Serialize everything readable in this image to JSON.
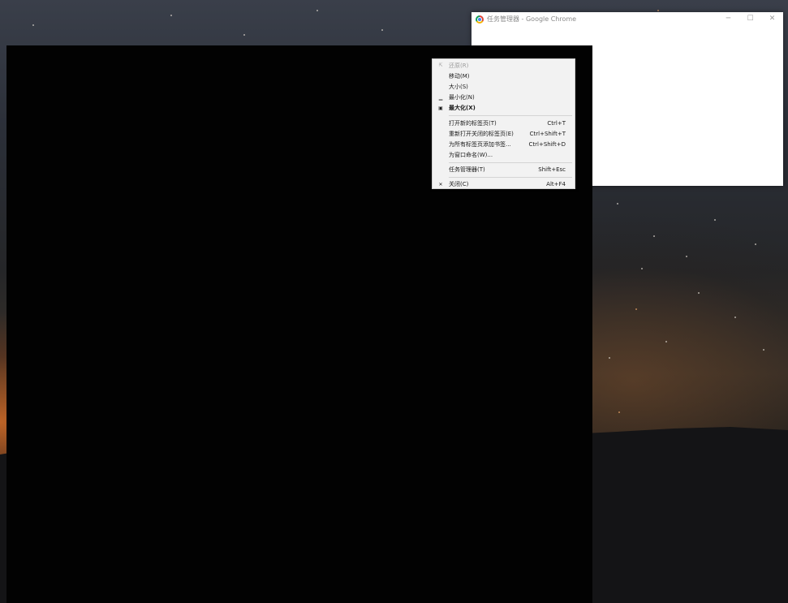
{
  "chrome_window": {
    "title": "任务管理器 - Google Chrome",
    "icon": "chrome-icon",
    "controls": {
      "minimize": "─",
      "maximize": "☐",
      "close": "✕"
    }
  },
  "system_menu": {
    "items": [
      {
        "label": "还原(R)",
        "icon": "⇱",
        "icon_name": "restore-icon",
        "shortcut": "",
        "disabled": true
      },
      {
        "label": "移动(M)",
        "icon": "",
        "icon_name": "",
        "shortcut": "",
        "disabled": false
      },
      {
        "label": "大小(S)",
        "icon": "",
        "icon_name": "",
        "shortcut": "",
        "disabled": false
      },
      {
        "label": "最小化(N)",
        "icon": "▁",
        "icon_name": "minimize-icon",
        "shortcut": "",
        "disabled": false
      },
      {
        "label": "最大化(X)",
        "icon": "▣",
        "icon_name": "maximize-icon",
        "shortcut": "",
        "disabled": false,
        "bold": true
      },
      {
        "label": "打开新的标签页(T)",
        "icon": "",
        "icon_name": "",
        "shortcut": "Ctrl+T",
        "disabled": false
      },
      {
        "label": "重新打开关闭的标签页(E)",
        "icon": "",
        "icon_name": "",
        "shortcut": "Ctrl+Shift+T",
        "disabled": false
      },
      {
        "label": "为所有标签页添加书签...",
        "icon": "",
        "icon_name": "",
        "shortcut": "Ctrl+Shift+D",
        "disabled": false
      },
      {
        "label": "为窗口命名(W)...",
        "icon": "",
        "icon_name": "",
        "shortcut": "",
        "disabled": false
      },
      {
        "label": "任务管理器(T)",
        "icon": "",
        "icon_name": "",
        "shortcut": "Shift+Esc",
        "disabled": false
      },
      {
        "label": "关闭(C)",
        "icon": "✕",
        "icon_name": "close-icon",
        "shortcut": "Alt+F4",
        "disabled": false
      }
    ]
  }
}
